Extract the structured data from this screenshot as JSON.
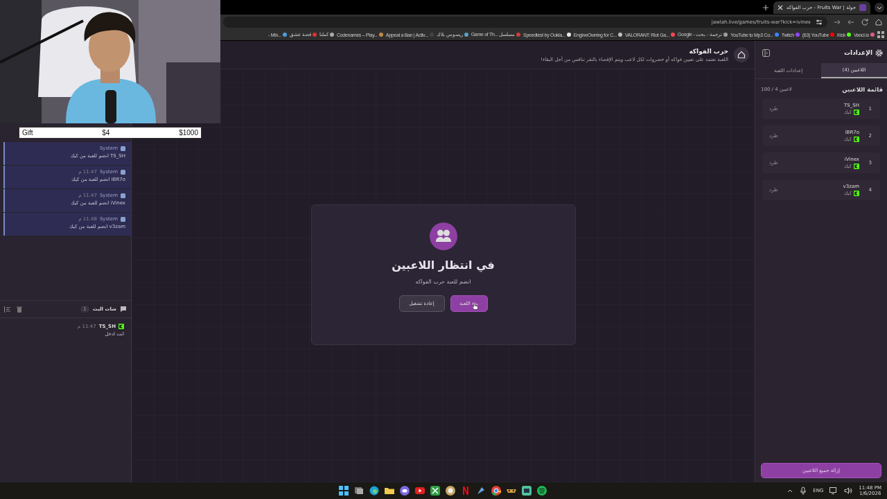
{
  "browser": {
    "tab": {
      "title": "جولة | Fruits War - حرب الفواكه",
      "selected": true
    },
    "url": "jawlah.live/games/fruits-war?kick=ivinex",
    "bookmarks": [
      {
        "label": "Vanci.io",
        "color": "#e05a8a"
      },
      {
        "label": "Kick",
        "color": "#53fc18"
      },
      {
        "label": "(63) YouTube",
        "color": "#ff0000"
      },
      {
        "label": "Twitch",
        "color": "#9146ff"
      },
      {
        "label": "YouTube to Mp3 Co...",
        "color": "#3b82f6"
      },
      {
        "label": "Google - ترجمة - بحث",
        "color": "#9aa0a6"
      },
      {
        "label": "VALORANT: Riot Ga...",
        "color": "#ff4655"
      },
      {
        "label": "EngineOwning for C...",
        "color": "#bdbdbd"
      },
      {
        "label": "Speedtest by Ookla...",
        "color": "#e8e8e8"
      },
      {
        "label": "Game of Th... مسلسل",
        "color": "#d23c3c"
      },
      {
        "label": "ريسوس بلاك",
        "color": "#5aa0c8"
      },
      {
        "label": "Appeal a Ban | Activ...",
        "color": "#444444"
      },
      {
        "label": "Codenames – Play...",
        "color": "#c08a4a"
      },
      {
        "label": "كملنا",
        "color": "#aaaaaa"
      },
      {
        "label": "قصة عشق",
        "color": "#e03030"
      },
      {
        "label": "- Min...",
        "color": "#4aa0e0"
      }
    ]
  },
  "overlay": {
    "gift": {
      "label": "Gift",
      "amount": "$4",
      "goal": "$1000"
    }
  },
  "chat": {
    "messages": [
      {
        "sender": "System",
        "text": "TS_SH انضم للعبة من كيك"
      },
      {
        "sender": "System",
        "time": "11:47 م",
        "text": "iBR7o انضم للعبة من كيك"
      },
      {
        "sender": "System",
        "time": "11:47 م",
        "text": "iVinex انضم للعبة من كيك"
      },
      {
        "sender": "System",
        "time": "11:48 م",
        "text": "v3zam انضم للعبة من كيك"
      }
    ],
    "live": {
      "title": "شات البث",
      "count": "1",
      "messages": [
        {
          "user": "TS_SH",
          "time": "11:47 م",
          "text": "انت ادخل"
        }
      ]
    }
  },
  "header": {
    "title": "حرب الفواكه",
    "description": "اللعبة تعتمد على تعيين فواكه أو خضروات لكل لاعب ويتم الإقصاء بالنقر تنافس من أجل البقاء!"
  },
  "waiting": {
    "title": "في انتظار اللاعبين",
    "subtitle": "انضم للعبة حرب الفواكه",
    "buttons": [
      {
        "label": "بدء اللعبة",
        "kind": "primary"
      },
      {
        "label": "إعادة تشغيل",
        "kind": "secondary"
      }
    ]
  },
  "sidebar": {
    "title": "الإعدادات",
    "tabs": [
      {
        "label": "اللاعبين (4)",
        "selected": true
      },
      {
        "label": "إعدادات اللعبة",
        "selected": false
      }
    ],
    "list_title": "قائمة اللاعبين",
    "count": "100 / 4 لاعبين",
    "players": [
      {
        "rank": "1",
        "name": "TS_SH",
        "platform": "كيك",
        "action": "طرد"
      },
      {
        "rank": "2",
        "name": "iBR7o",
        "platform": "كيك",
        "action": "طرد"
      },
      {
        "rank": "3",
        "name": "iVinex",
        "platform": "كيك",
        "action": "طرد"
      },
      {
        "rank": "4",
        "name": "v3zam",
        "platform": "كيك",
        "action": "طرد"
      }
    ],
    "remove_all": "إزالة جميع اللاعبين"
  },
  "taskbar": {
    "language": "ENG",
    "time": "11:48 PM",
    "date": "1/6/2026"
  }
}
